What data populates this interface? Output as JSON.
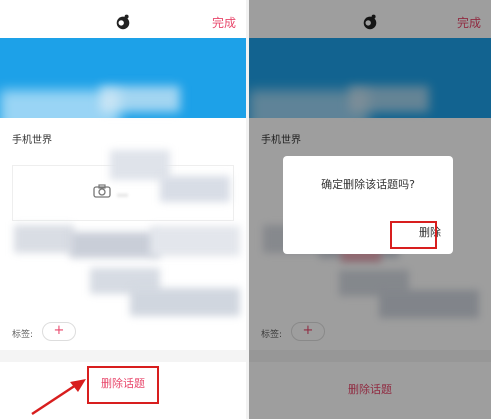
{
  "left": {
    "done_label": "完成",
    "section_title": "手机世界",
    "upload_label": "…",
    "tags_label": "标签:",
    "tag_add": "+",
    "delete_label": "删除话题"
  },
  "right": {
    "done_label": "完成",
    "section_title": "手机世界",
    "dialog_message": "确定删除该话题吗?",
    "dialog_confirm": "删除",
    "tags_label": "标签:",
    "tag_add": "+",
    "delete_label": "删除话题"
  },
  "colors": {
    "accent": "#e8476b",
    "banner": "#1da1e8",
    "highlight": "#d81e1e"
  },
  "icons": [
    "app-logo-icon",
    "camera-icon",
    "arrow-icon"
  ]
}
